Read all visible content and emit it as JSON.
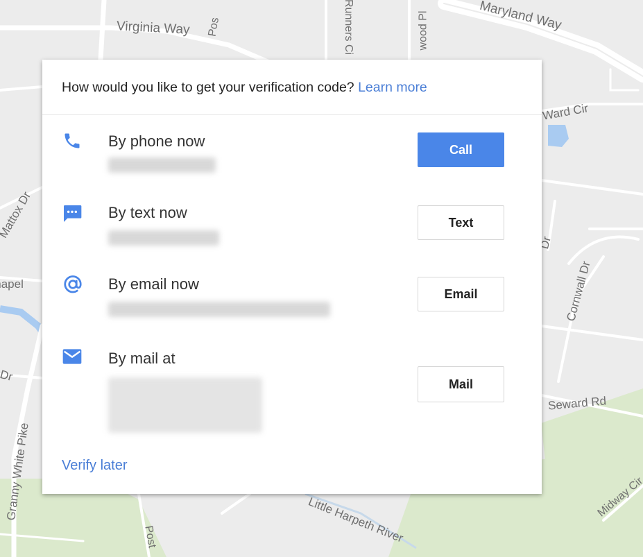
{
  "map": {
    "labels": {
      "virginia_way": "Virginia Way",
      "maryland_way": "Maryland Way",
      "ward_cir": "Ward Cir",
      "cornwall_dr": "Cornwall Dr",
      "seward_rd": "Seward Rd",
      "granny_white_pike": "Granny White Pike",
      "little_harpeth_river": "Little Harpeth River",
      "midway_cir": "Midway Cir",
      "post": "Post",
      "chapel": "Chapel",
      "mattox_dr": "Mattox Dr",
      "dr": "Dr",
      "runners_cir": "Runners Ci",
      "wood_pl": "wood Pl",
      "post_top": "Pos",
      "dr_right": "Dr"
    }
  },
  "dialog": {
    "prompt": "How would you like to get your verification code?",
    "learn_more": "Learn more",
    "options": [
      {
        "icon": "phone-icon",
        "title": "By phone now",
        "button": "Call"
      },
      {
        "icon": "sms-icon",
        "title": "By text now",
        "button": "Text"
      },
      {
        "icon": "at-sign-icon",
        "title": "By email now",
        "button": "Email"
      },
      {
        "icon": "envelope-icon",
        "title": "By mail at",
        "button": "Mail"
      }
    ],
    "verify_later": "Verify later"
  },
  "colors": {
    "accent": "#4a86e8",
    "link": "#4a7ed6",
    "map_bg": "#ececec",
    "park": "#dbe9cc",
    "water": "#a9cbf1"
  }
}
